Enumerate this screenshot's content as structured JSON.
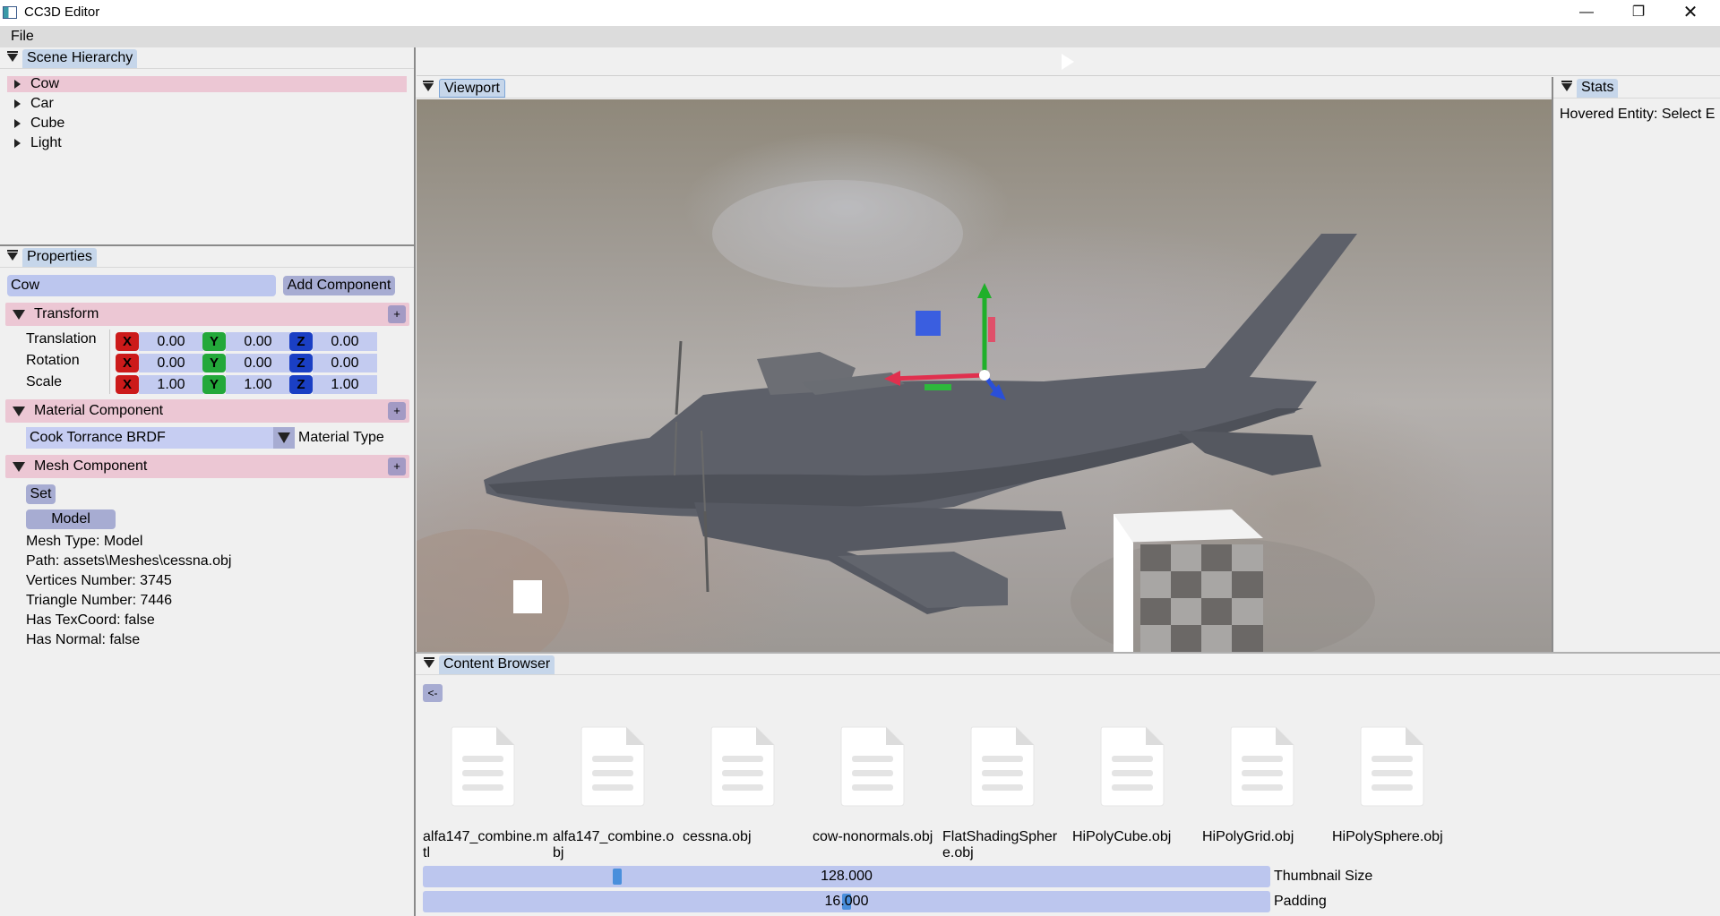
{
  "window": {
    "title": "CC3D Editor",
    "minimize_glyph": "—",
    "maximize_glyph": "❐",
    "close_glyph": "✕"
  },
  "menu": {
    "file": "File"
  },
  "scene_hierarchy": {
    "tab": "Scene Hierarchy",
    "items": [
      {
        "label": "Cow",
        "selected": true
      },
      {
        "label": "Car"
      },
      {
        "label": "Cube"
      },
      {
        "label": "Light"
      }
    ]
  },
  "properties": {
    "tab": "Properties",
    "entity_name": "Cow",
    "add_component": "Add Component",
    "transform": {
      "title": "Transform",
      "plus": "+",
      "rows": [
        {
          "label": "Translation",
          "x": "0.00",
          "y": "0.00",
          "z": "0.00"
        },
        {
          "label": "Rotation",
          "x": "0.00",
          "y": "0.00",
          "z": "0.00"
        },
        {
          "label": "Scale",
          "x": "1.00",
          "y": "1.00",
          "z": "1.00"
        }
      ],
      "axis_x": "X",
      "axis_y": "Y",
      "axis_z": "Z"
    },
    "material": {
      "title": "Material Component",
      "plus": "+",
      "selected_type": "Cook Torrance BRDF",
      "type_label": "Material Type"
    },
    "mesh": {
      "title": "Mesh Component",
      "plus": "+",
      "set_button": "Set",
      "model_button": "Model",
      "mesh_type": "Mesh Type: Model",
      "path": "Path: assets\\Meshes\\cessna.obj",
      "vertices": "Vertices Number: 3745",
      "triangles": "Triangle Number: 7446",
      "texcoord": "Has TexCoord: false",
      "normal": "Has Normal: false"
    }
  },
  "viewport": {
    "tab": "Viewport"
  },
  "stats": {
    "tab": "Stats",
    "hovered": "Hovered Entity: Select E"
  },
  "content_browser": {
    "tab": "Content Browser",
    "back": "<-",
    "files": [
      {
        "name": "alfa147_combine.mtl"
      },
      {
        "name": "alfa147_combine.obj"
      },
      {
        "name": "cessna.obj"
      },
      {
        "name": "cow-nonormals.obj"
      },
      {
        "name": "FlatShadingSphere.obj"
      },
      {
        "name": "HiPolyCube.obj"
      },
      {
        "name": "HiPolyGrid.obj"
      },
      {
        "name": "HiPolySphere.obj"
      }
    ],
    "thumbnail_size": {
      "value": "128.000",
      "label": "Thumbnail Size"
    },
    "padding": {
      "value": "16.000",
      "label": "Padding"
    }
  },
  "colors": {
    "selection": "#ecc7d4",
    "tab": "#c6d6ea",
    "widget": "#bcc6ee",
    "button": "#a7acd2",
    "axis_x": "#cc1a1a",
    "axis_y": "#23a83a",
    "axis_z": "#1a3fc4"
  }
}
